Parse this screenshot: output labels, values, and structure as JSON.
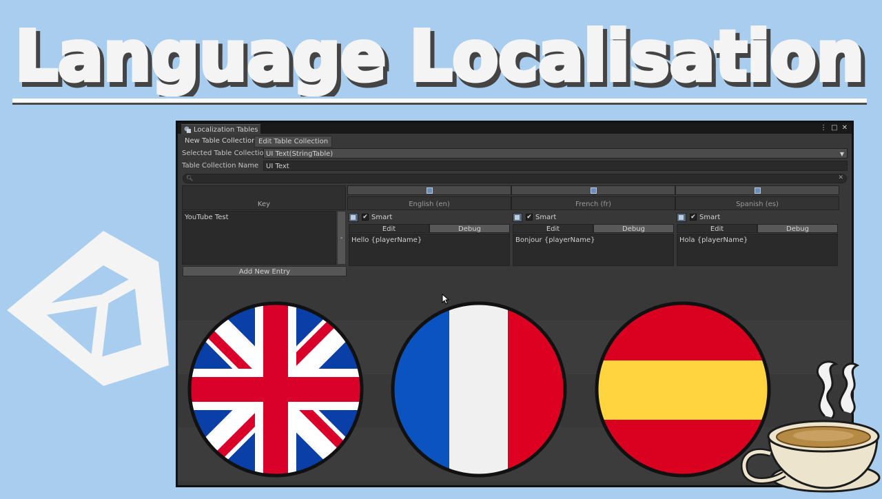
{
  "headline": {
    "text": "Language Localisation"
  },
  "window": {
    "tab_title": "Localization Tables",
    "controls": [
      "⋮",
      "□",
      "✕"
    ],
    "top_buttons": {
      "new": "New Table Collection",
      "edit": "Edit Table Collection"
    },
    "selected_table_label": "Selected Table Collection",
    "selected_table_value": "UI Text(StringTable)",
    "collection_name_label": "Table Collection Name",
    "collection_name_value": "UI Text",
    "search_placeholder": "",
    "key_header": "Key",
    "languages": [
      {
        "name": "English (en)",
        "smart_label": "Smart",
        "edit_label": "Edit",
        "debug_label": "Debug",
        "value": "Hello {playerName}"
      },
      {
        "name": "French (fr)",
        "smart_label": "Smart",
        "edit_label": "Edit",
        "debug_label": "Debug",
        "value": "Bonjour {playerName}"
      },
      {
        "name": "Spanish (es)",
        "smart_label": "Smart",
        "edit_label": "Edit",
        "debug_label": "Debug",
        "value": "Hola {playerName}"
      }
    ],
    "entry_key": "YouTube Test",
    "remove_label": "-",
    "add_entry_label": "Add New Entry"
  },
  "flags": [
    {
      "name": "united-kingdom-flag",
      "colors": [
        "#0b3fa8",
        "#ffffff",
        "#d9002a"
      ]
    },
    {
      "name": "france-flag",
      "colors": [
        "#0a53c0",
        "#f0f0f0",
        "#dd0021"
      ]
    },
    {
      "name": "spain-flag",
      "colors": [
        "#d90020",
        "#ffd43f"
      ]
    }
  ],
  "colors": {
    "background": "#a8cdee",
    "editor_bg": "#383838",
    "field_bg": "#2a2a2a"
  }
}
